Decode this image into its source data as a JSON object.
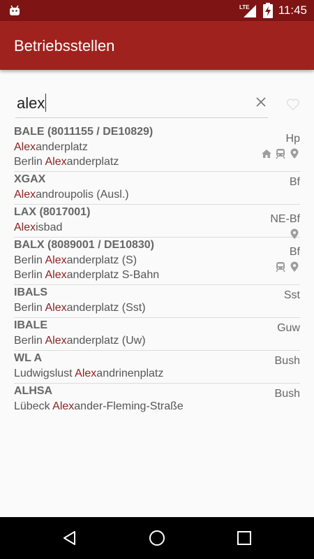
{
  "status": {
    "network": "LTE",
    "time": "11:45"
  },
  "appbar": {
    "title": "Betriebsstellen"
  },
  "search": {
    "value": "alex"
  },
  "colors": {
    "primary": "#a0221e",
    "status_bar": "#7e1414",
    "highlight": "#8a1f1f"
  },
  "icons": {
    "status": [
      "android-icon",
      "lte-signal-icon",
      "battery-charging-icon"
    ],
    "search": [
      "clear-icon",
      "favorite-heart-icon"
    ],
    "row": [
      "home-icon",
      "train-icon",
      "location-pin-icon"
    ],
    "nav": [
      "back-icon",
      "home-circle-icon",
      "recents-icon"
    ]
  },
  "results": [
    {
      "code": "BALE (8011155 / DE10829)",
      "type": "Hp",
      "lines": [
        {
          "pre": "",
          "hl": "Alex",
          "post": "anderplatz"
        },
        {
          "pre": "Berlin ",
          "hl": "Alex",
          "post": "anderplatz"
        }
      ],
      "icons": [
        "home-icon",
        "train-icon",
        "location-pin-icon"
      ]
    },
    {
      "code": "XGAX",
      "type": "Bf",
      "lines": [
        {
          "pre": "",
          "hl": "Alex",
          "post": "androupolis (Ausl.)"
        }
      ],
      "icons": []
    },
    {
      "code": "LAX (8017001)",
      "type": "NE-Bf",
      "lines": [
        {
          "pre": "",
          "hl": "Alex",
          "post": "isbad"
        }
      ],
      "icons": [
        "location-pin-icon"
      ]
    },
    {
      "code": "BALX (8089001 / DE10830)",
      "type": "Bf",
      "lines": [
        {
          "pre": "Berlin ",
          "hl": "Alex",
          "post": "anderplatz (S)"
        },
        {
          "pre": "Berlin ",
          "hl": "Alex",
          "post": "anderplatz S-Bahn"
        }
      ],
      "icons": [
        "train-icon",
        "location-pin-icon"
      ]
    },
    {
      "code": "IBALS",
      "type": "Sst",
      "lines": [
        {
          "pre": "Berlin ",
          "hl": "Alex",
          "post": "anderplatz (Sst)"
        }
      ],
      "icons": []
    },
    {
      "code": "IBALE",
      "type": "Guw",
      "lines": [
        {
          "pre": "Berlin ",
          "hl": "Alex",
          "post": "anderplatz (Uw)"
        }
      ],
      "icons": []
    },
    {
      "code": "WL A",
      "type": "Bush",
      "lines": [
        {
          "pre": "Ludwigslust ",
          "hl": "Alex",
          "post": "andrinenplatz"
        }
      ],
      "icons": []
    },
    {
      "code": "ALHSA",
      "type": "Bush",
      "lines": [
        {
          "pre": "Lübeck ",
          "hl": "Alex",
          "post": "ander-Fleming-Straße"
        }
      ],
      "icons": []
    }
  ]
}
